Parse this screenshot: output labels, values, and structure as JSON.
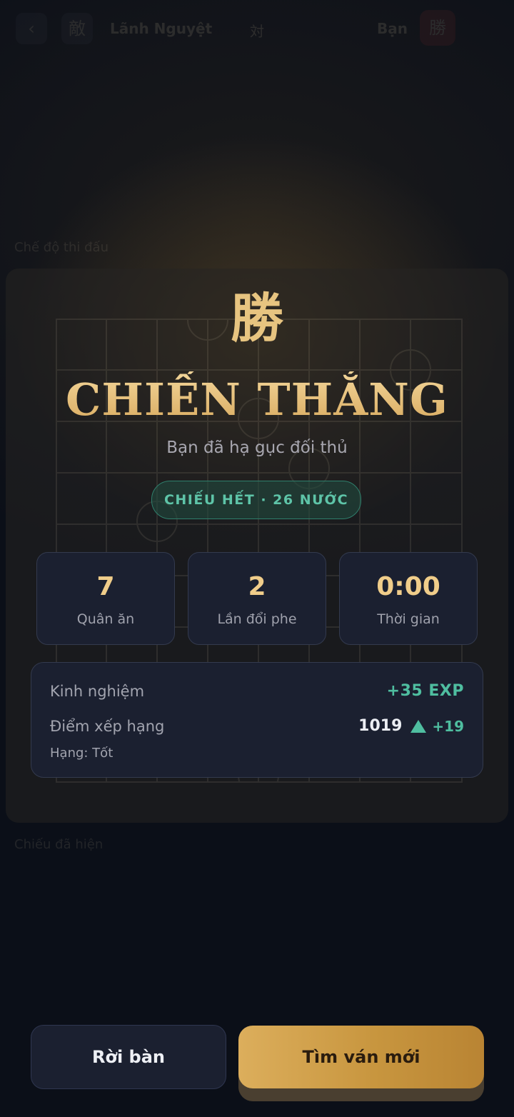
{
  "background": {
    "topbar": {
      "back_glyph": "‹",
      "opponent_avatar": "敵",
      "opponent_name": "Lãnh Nguyệt",
      "vs_glyph": "対",
      "you_label": "Bạn",
      "you_avatar": "勝"
    },
    "caption_top": "Chế độ thi đấu",
    "caption_bottom": "Chiếu đã hiện"
  },
  "result": {
    "glyph": "勝",
    "title": "CHIẾN THẮNG",
    "subtitle": "Bạn đã hạ gục đối thủ",
    "badge": "CHIẾU HẾT · 26 NƯỚC"
  },
  "stats": [
    {
      "value": "7",
      "label": "Quân ăn"
    },
    {
      "value": "2",
      "label": "Lần đổi phe"
    },
    {
      "value": "0:00",
      "label": "Thời gian"
    }
  ],
  "rewards": {
    "exp_label": "Kinh nghiệm",
    "exp_value": "+35 EXP",
    "rank_label": "Điểm xếp hạng",
    "rank_value": "1019",
    "rank_delta": "+19",
    "tier": "Hạng: Tốt"
  },
  "actions": {
    "leave": "Rời bàn",
    "new_game": "Tìm ván mới"
  },
  "colors": {
    "gold": "#e6c17b",
    "teal": "#4fbea0",
    "card": "#1b2030",
    "background": "#0b0f18"
  }
}
